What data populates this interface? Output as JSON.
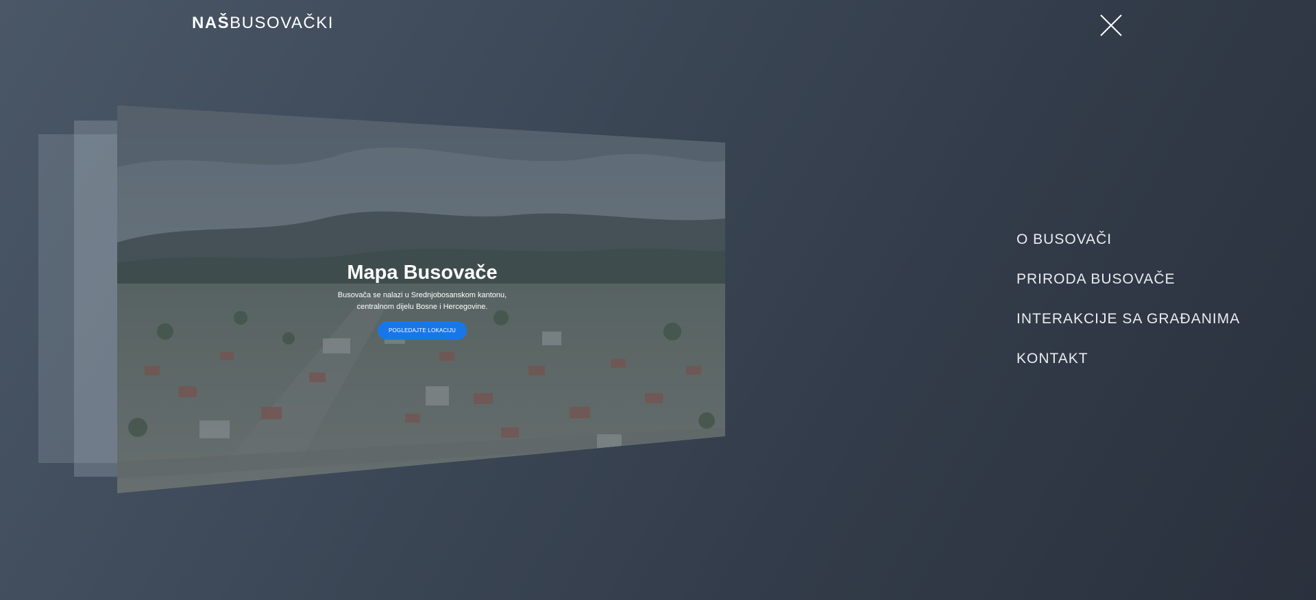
{
  "header": {
    "logo_bold": "NAŠ",
    "logo_light": "BUSOVAČKI"
  },
  "slide": {
    "title": "Mapa Busovače",
    "description_line1": "Busovača se nalazi u Srednjobosanskom kantonu,",
    "description_line2": "centralnom dijelu Bosne i Hercegovine.",
    "button_label": "POGLEDAJTE LOKACIJU"
  },
  "nav": {
    "items": [
      {
        "label": "O BUSOVAČI"
      },
      {
        "label": "PRIRODA BUSOVAČE"
      },
      {
        "label": "INTERAKCIJE SA GRAĐANIMA"
      },
      {
        "label": "KONTAKT"
      }
    ]
  },
  "icons": {
    "close": "close-icon"
  },
  "colors": {
    "background": "#3d4958",
    "accent": "#1877e8",
    "text": "#ffffff"
  }
}
